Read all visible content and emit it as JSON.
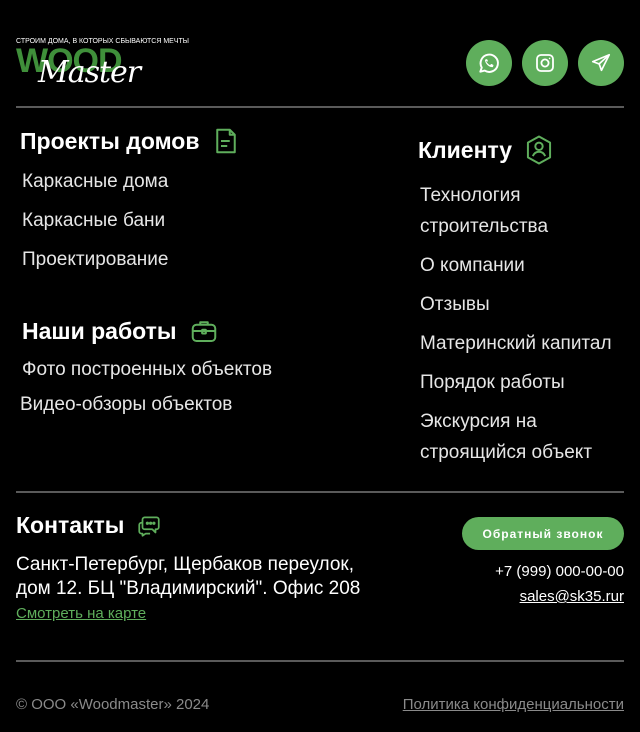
{
  "logo": {
    "tagline": "СТРОИМ ДОМА, В КОТОРЫХ СБЫВАЮТСЯ МЕЧТЫ",
    "word1": "WOOD",
    "word2": "Master"
  },
  "social": [
    {
      "name": "whatsapp"
    },
    {
      "name": "instagram"
    },
    {
      "name": "telegram"
    }
  ],
  "projects": {
    "title": "Проекты домов",
    "items": [
      "Каркасные дома",
      "Каркасные бани",
      "Проектирование"
    ]
  },
  "works": {
    "title": "Наши работы",
    "items": [
      "Фото построенных объектов",
      "Видео-обзоры объектов"
    ]
  },
  "client": {
    "title": "Клиенту",
    "items": [
      "Технология",
      "строительства",
      "О компании",
      "Отзывы",
      "Материнский капитал",
      "Порядок работы",
      "Экскурсия на",
      "строящийся объект"
    ]
  },
  "contacts": {
    "title": "Контакты",
    "address_line1": "Санкт-Петербург, Щербаков переулок,",
    "address_line2": "дом 12. БЦ \"Владимирский\". Офис 208",
    "map_link": "Смотреть на карте",
    "callback": "Обратный звонок",
    "phone": "+7 (999) 000-00-00",
    "email": "sales@sk35.rur"
  },
  "footer": {
    "copyright": "© ООО «Woodmaster» 2024",
    "policy": "Политика конфиденциальности"
  },
  "colors": {
    "accent": "#5fae5c",
    "background": "#000000",
    "divider": "#5a5a5a"
  }
}
